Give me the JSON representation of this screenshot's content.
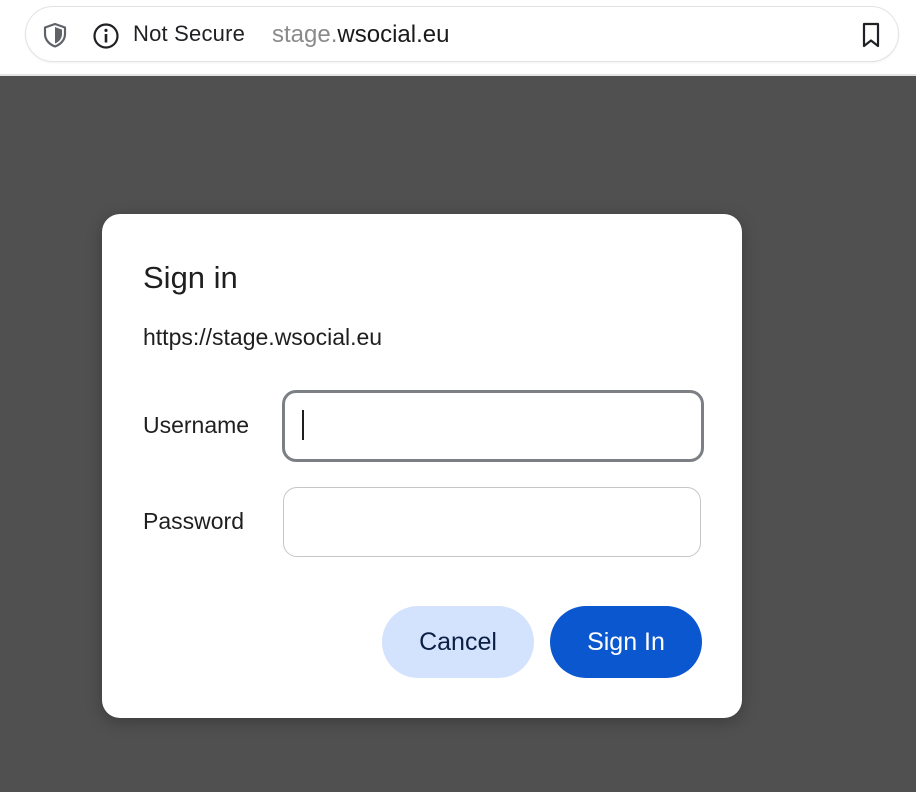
{
  "browser": {
    "security_label": "Not Secure",
    "url_subdomain": "stage.",
    "url_domain": "wsocial.eu",
    "icons": {
      "shield": "shield-icon",
      "info": "info-icon",
      "bookmark": "bookmark-icon"
    }
  },
  "dialog": {
    "title": "Sign in",
    "origin": "https://stage.wsocial.eu",
    "username_label": "Username",
    "username_value": "",
    "password_label": "Password",
    "password_value": "",
    "cancel_label": "Cancel",
    "signin_label": "Sign In"
  },
  "colors": {
    "backdrop": "#505050",
    "primary": "#0b57d0",
    "secondary": "#d3e3fd"
  }
}
